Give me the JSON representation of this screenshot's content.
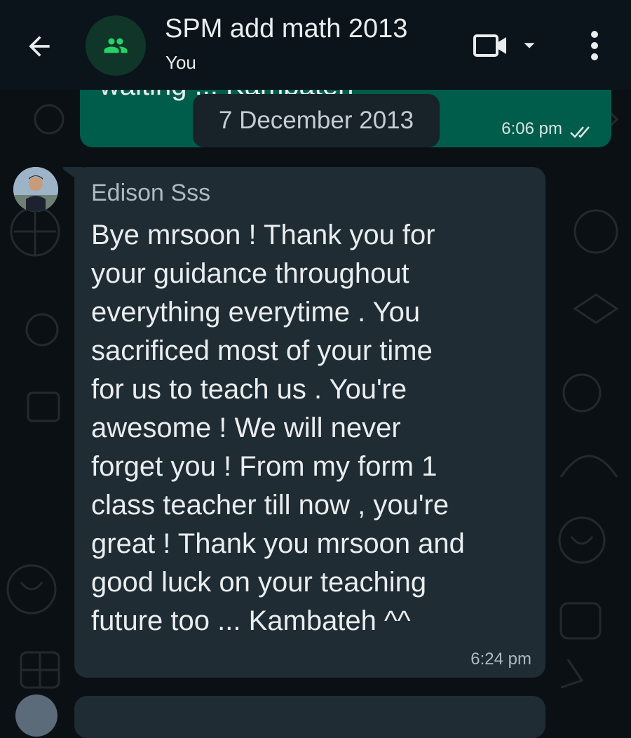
{
  "header": {
    "title": "SPM add math 2013",
    "subtitle": "You",
    "icons": [
      "back-arrow-icon",
      "group-icon",
      "video-call-icon",
      "dropdown-caret-icon",
      "more-vert-icon"
    ]
  },
  "previous_message": {
    "partial_text": "waiting ... Kambateh",
    "time": "6:06 pm",
    "status": "read"
  },
  "date_separator": "7 December 2013",
  "message": {
    "sender": "Edison Sss",
    "text": "Bye mrsoon ! Thank you for\nyour guidance throughout\neverything everytime . You\nsacrificed most of your time\nfor us to teach us . You're\nawesome ! We will never\nforget you ! From my form 1\nclass teacher till now , you're\ngreat ! Thank you mrsoon and\ngood luck on your teaching\nfuture too ... Kambateh ^^",
    "time": "6:24 pm"
  },
  "colors": {
    "header_bg": "#0b141a",
    "chat_bg": "#0b1014",
    "outgoing_bubble": "#005c4b",
    "incoming_bubble": "#1f2c33",
    "date_chip": "#182229",
    "accent": "#25d366"
  }
}
